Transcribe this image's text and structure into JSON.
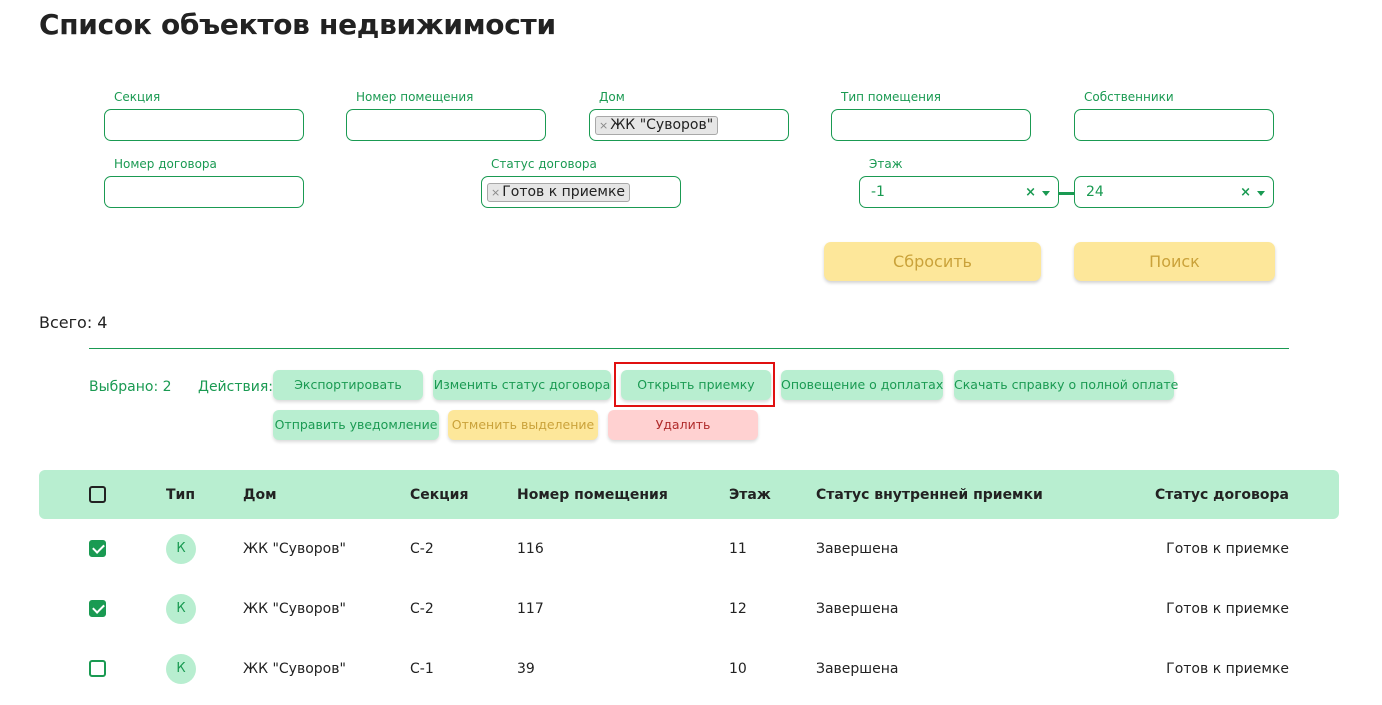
{
  "page": {
    "title": "Список объектов недвижимости"
  },
  "filters": {
    "section": {
      "label": "Секция",
      "value": ""
    },
    "room_number": {
      "label": "Номер помещения",
      "value": ""
    },
    "house": {
      "label": "Дом",
      "tag": "ЖК \"Суворов\""
    },
    "room_type": {
      "label": "Тип помещения",
      "value": ""
    },
    "owners": {
      "label": "Собственники",
      "value": ""
    },
    "contract_number": {
      "label": "Номер договора",
      "value": ""
    },
    "contract_status": {
      "label": "Статус договора",
      "tag": "Готов к приемке"
    },
    "floor": {
      "label": "Этаж",
      "from": "-1",
      "to": "24"
    },
    "clear_glyph": "×",
    "reset_label": "Сбросить",
    "search_label": "Поиск"
  },
  "summary": {
    "total": "Всего: 4",
    "selected": "Выбрано: 2",
    "actions_label": "Действия:"
  },
  "actions": {
    "export": "Экспортировать",
    "change_status": "Изменить статус договора",
    "open_acceptance": "Открыть приемку",
    "notify_payments": "Оповещение о доплатах",
    "download_certificate": "Скачать справку о полной оплате",
    "send_notification": "Отправить уведомление",
    "cancel_selection": "Отменить выделение",
    "delete": "Удалить"
  },
  "table": {
    "columns": [
      "Тип",
      "Дом",
      "Секция",
      "Номер помещения",
      "Этаж",
      "Статус внутренней приемки",
      "Статус договора"
    ],
    "rows": [
      {
        "checked": true,
        "type": "К",
        "house": "ЖК \"Суворов\"",
        "section": "С-2",
        "number": "116",
        "floor": "11",
        "acceptance": "Завершена",
        "contract": "Готов к приемке"
      },
      {
        "checked": true,
        "type": "К",
        "house": "ЖК \"Суворов\"",
        "section": "С-2",
        "number": "117",
        "floor": "12",
        "acceptance": "Завершена",
        "contract": "Готов к приемке"
      },
      {
        "checked": false,
        "type": "К",
        "house": "ЖК \"Суворов\"",
        "section": "С-1",
        "number": "39",
        "floor": "10",
        "acceptance": "Завершена",
        "contract": "Готов к приемке"
      }
    ]
  },
  "colors": {
    "accent": "#1a9a52",
    "accent_light": "#b8eed0",
    "yellow": "#fde79a",
    "red_light": "#ffd1d1",
    "highlight": "#e01010"
  }
}
